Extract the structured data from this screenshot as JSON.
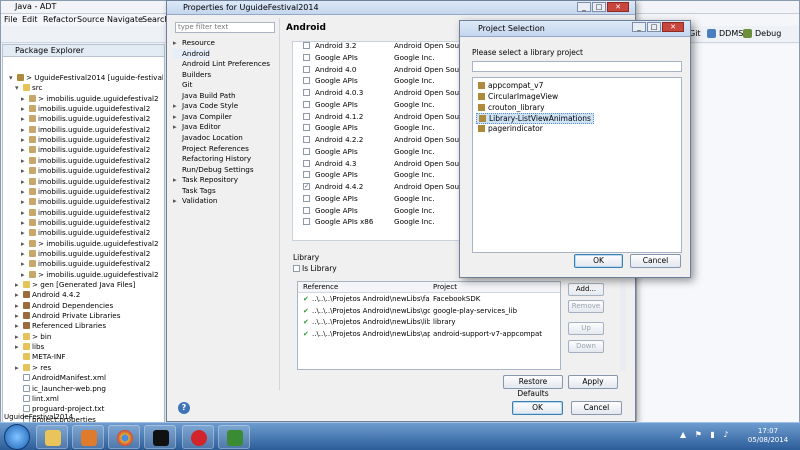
{
  "window": {
    "title": "Java - ADT"
  },
  "menu": [
    "File",
    "Edit",
    "Refactor",
    "Source",
    "Navigate",
    "Search"
  ],
  "perspectives": {
    "git": "Git",
    "ddms": "DDMS",
    "debug": "Debug"
  },
  "package_explorer": {
    "tab": "Package Explorer",
    "rows": [
      {
        "t": "> UguideFestival2014  [uguide-festival",
        "i": "proj",
        "d": 1,
        "tw": "▾"
      },
      {
        "t": "src",
        "i": "fold",
        "d": 2,
        "tw": "▾"
      },
      {
        "t": "> imobilis.uguide.uguidefestival2",
        "i": "pkg",
        "d": 3,
        "tw": "▸"
      },
      {
        "t": "imobilis.uguide.uguidefestival2",
        "i": "pkg",
        "d": 3,
        "tw": "▸"
      },
      {
        "t": "imobilis.uguide.uguidefestival2",
        "i": "pkg",
        "d": 3,
        "tw": "▸"
      },
      {
        "t": "imobilis.uguide.uguidefestival2",
        "i": "pkg",
        "d": 3,
        "tw": "▸"
      },
      {
        "t": "imobilis.uguide.uguidefestival2",
        "i": "pkg",
        "d": 3,
        "tw": "▸"
      },
      {
        "t": "imobilis.uguide.uguidefestival2",
        "i": "pkg",
        "d": 3,
        "tw": "▸"
      },
      {
        "t": "imobilis.uguide.uguidefestival2",
        "i": "pkg",
        "d": 3,
        "tw": "▸"
      },
      {
        "t": "imobilis.uguide.uguidefestival2",
        "i": "pkg",
        "d": 3,
        "tw": "▸"
      },
      {
        "t": "imobilis.uguide.uguidefestival2",
        "i": "pkg",
        "d": 3,
        "tw": "▸"
      },
      {
        "t": "imobilis.uguide.uguidefestival2",
        "i": "pkg",
        "d": 3,
        "tw": "▸"
      },
      {
        "t": "imobilis.uguide.uguidefestival2",
        "i": "pkg",
        "d": 3,
        "tw": "▸"
      },
      {
        "t": "imobilis.uguide.uguidefestival2",
        "i": "pkg",
        "d": 3,
        "tw": "▸"
      },
      {
        "t": "imobilis.uguide.uguidefestival2",
        "i": "pkg",
        "d": 3,
        "tw": "▸"
      },
      {
        "t": "imobilis.uguide.uguidefestival2",
        "i": "pkg",
        "d": 3,
        "tw": "▸"
      },
      {
        "t": "> imobilis.uguide.uguidefestival2",
        "i": "pkg",
        "d": 3,
        "tw": "▸"
      },
      {
        "t": "imobilis.uguide.uguidefestival2",
        "i": "pkg",
        "d": 3,
        "tw": "▸"
      },
      {
        "t": "imobilis.uguide.uguidefestival2",
        "i": "pkg",
        "d": 3,
        "tw": "▸"
      },
      {
        "t": "> imobilis.uguide.uguidefestival2",
        "i": "pkg",
        "d": 3,
        "tw": "▸"
      },
      {
        "t": "> gen [Generated Java Files]",
        "i": "fold",
        "d": 2,
        "tw": "▸"
      },
      {
        "t": "Android 4.4.2",
        "i": "lib",
        "d": 2,
        "tw": "▸"
      },
      {
        "t": "Android Dependencies",
        "i": "lib",
        "d": 2,
        "tw": "▸"
      },
      {
        "t": "Android Private Libraries",
        "i": "lib",
        "d": 2,
        "tw": "▸"
      },
      {
        "t": "Referenced Libraries",
        "i": "lib",
        "d": 2,
        "tw": "▸"
      },
      {
        "t": "> bin",
        "i": "fold",
        "d": 2,
        "tw": "▸"
      },
      {
        "t": "libs",
        "i": "fold",
        "d": 2,
        "tw": "▸"
      },
      {
        "t": "META-INF",
        "i": "fold",
        "d": 2,
        "tw": ""
      },
      {
        "t": "> res",
        "i": "fold",
        "d": 2,
        "tw": "▸"
      },
      {
        "t": "AndroidManifest.xml",
        "i": "file",
        "d": 2,
        "tw": ""
      },
      {
        "t": "ic_launcher-web.png",
        "i": "file",
        "d": 2,
        "tw": ""
      },
      {
        "t": "lint.xml",
        "i": "file",
        "d": 2,
        "tw": ""
      },
      {
        "t": "proguard-project.txt",
        "i": "file",
        "d": 2,
        "tw": ""
      },
      {
        "t": "project.properties",
        "i": "file",
        "d": 2,
        "tw": ""
      }
    ]
  },
  "status_bar": "UguideFestival2014",
  "properties_dialog": {
    "title": "Properties for UguideFestival2014",
    "filter_placeholder": "type filter text",
    "page_title": "Android",
    "nav": [
      {
        "l": "Resource",
        "tw": "▸"
      },
      {
        "l": "Android",
        "tw": ""
      },
      {
        "l": "Android Lint Preferences",
        "tw": ""
      },
      {
        "l": "Builders",
        "tw": ""
      },
      {
        "l": "Git",
        "tw": ""
      },
      {
        "l": "Java Build Path",
        "tw": ""
      },
      {
        "l": "Java Code Style",
        "tw": "▸"
      },
      {
        "l": "Java Compiler",
        "tw": "▸"
      },
      {
        "l": "Java Editor",
        "tw": "▸"
      },
      {
        "l": "Javadoc Location",
        "tw": ""
      },
      {
        "l": "Project References",
        "tw": ""
      },
      {
        "l": "Refactoring History",
        "tw": ""
      },
      {
        "l": "Run/Debug Settings",
        "tw": ""
      },
      {
        "l": "Task Repository",
        "tw": "▸"
      },
      {
        "l": "Task Tags",
        "tw": ""
      },
      {
        "l": "Validation",
        "tw": "▸"
      }
    ],
    "targets": [
      {
        "n": "Android 3.2",
        "v": "Android Open Source",
        "c": false
      },
      {
        "n": "Google APIs",
        "v": "Google Inc.",
        "c": false
      },
      {
        "n": "Android 4.0",
        "v": "Android Open Source",
        "c": false
      },
      {
        "n": "Google APIs",
        "v": "Google Inc.",
        "c": false
      },
      {
        "n": "Android 4.0.3",
        "v": "Android Open Source",
        "c": false
      },
      {
        "n": "Google APIs",
        "v": "Google Inc.",
        "c": false
      },
      {
        "n": "Android 4.1.2",
        "v": "Android Open Source",
        "c": false
      },
      {
        "n": "Google APIs",
        "v": "Google Inc.",
        "c": false
      },
      {
        "n": "Android 4.2.2",
        "v": "Android Open Source",
        "c": false
      },
      {
        "n": "Google APIs",
        "v": "Google Inc.",
        "c": false
      },
      {
        "n": "Android 4.3",
        "v": "Android Open Source",
        "c": false
      },
      {
        "n": "Google APIs",
        "v": "Google Inc.",
        "c": false
      },
      {
        "n": "Android 4.4.2",
        "v": "Android Open Source",
        "c": true
      },
      {
        "n": "Google APIs",
        "v": "Google Inc.",
        "c": false
      },
      {
        "n": "Google APIs",
        "v": "Google Inc.",
        "c": false
      },
      {
        "n": "Google APIs x86",
        "v": "Google Inc.",
        "c": false
      }
    ],
    "library_label": "Library",
    "is_library": "Is Library",
    "ref_headers": {
      "reference": "Reference",
      "project": "Project"
    },
    "references": [
      {
        "p": "..\\..\\..\\Projetos Android\\newLibs\\fa...",
        "prj": "FacebookSDK"
      },
      {
        "p": "..\\..\\..\\Projetos Android\\newLibs\\go...",
        "prj": "google-play-services_lib"
      },
      {
        "p": "..\\..\\..\\Projetos Android\\newLibs\\lib...",
        "prj": "library"
      },
      {
        "p": "..\\..\\..\\Projetos Android\\newLibs\\ap...",
        "prj": "android-support-v7-appcompat"
      }
    ],
    "side_buttons": {
      "add": "Add...",
      "remove": "Remove",
      "up": "Up",
      "down": "Down"
    },
    "restore": "Restore Defaults",
    "apply": "Apply",
    "ok": "OK",
    "cancel": "Cancel"
  },
  "project_selection": {
    "title": "Project Selection",
    "prompt": "Please select a library project",
    "items": [
      "appcompat_v7",
      "CircularImageView",
      "crouton_library",
      "Library-ListViewAnimations",
      "pagerindicator"
    ],
    "selected": 3,
    "ok": "OK",
    "cancel": "Cancel"
  },
  "taskbar": {
    "time": "17:07",
    "date": "05/08/2014"
  }
}
